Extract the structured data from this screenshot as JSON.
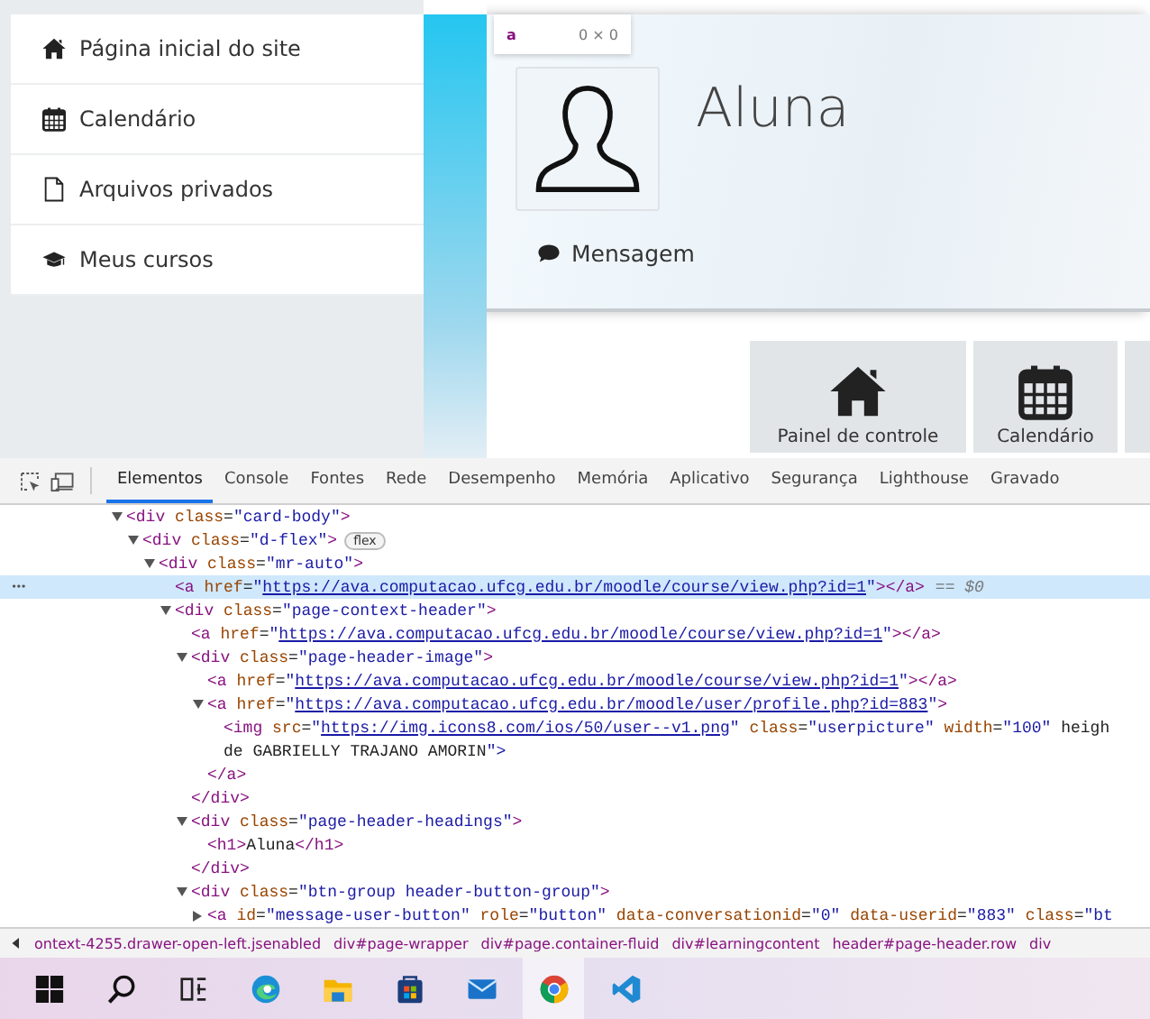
{
  "sidebar": {
    "items": [
      {
        "label": "Página inicial do site"
      },
      {
        "label": "Calendário"
      },
      {
        "label": "Arquivos privados"
      },
      {
        "label": "Meus cursos"
      }
    ]
  },
  "inspect_tooltip": {
    "tag": "a",
    "size": "0 × 0"
  },
  "page_header": {
    "name": "Aluna",
    "message_button": "Mensagem"
  },
  "tiles": [
    {
      "label": "Painel de controle"
    },
    {
      "label": "Calendário"
    }
  ],
  "devtools": {
    "tabs": [
      {
        "label": "Elementos",
        "selected": true
      },
      {
        "label": "Console",
        "selected": false
      },
      {
        "label": "Fontes",
        "selected": false
      },
      {
        "label": "Rede",
        "selected": false
      },
      {
        "label": "Desempenho",
        "selected": false
      },
      {
        "label": "Memória",
        "selected": false
      },
      {
        "label": "Aplicativo",
        "selected": false
      },
      {
        "label": "Segurança",
        "selected": false
      },
      {
        "label": "Lighthouse",
        "selected": false
      },
      {
        "label": "Gravado",
        "selected": false
      }
    ],
    "dom_tree": [
      {
        "open": "<div class=\"card-body\">",
        "expanded": true,
        "selected": false,
        "children": [
          {
            "open": "<div class=\"d-flex\">",
            "badge": "flex",
            "expanded": true,
            "selected": false,
            "children": [
              {
                "open": "<div class=\"mr-auto\">",
                "expanded": true,
                "selected": false,
                "children": [
                  {
                    "open": "<a href=\"https://ava.computacao.ufcg.edu.br/moodle/course/view.php?id=1\"></a>",
                    "suffix": "== $0",
                    "menu": "•••",
                    "selected": true
                  },
                  {
                    "open": "<div class=\"page-context-header\">",
                    "expanded": true,
                    "selected": false,
                    "children": [
                      {
                        "open": "<a href=\"https://ava.computacao.ufcg.edu.br/moodle/course/view.php?id=1\"></a>",
                        "selected": false
                      },
                      {
                        "open": "<div class=\"page-header-image\">",
                        "expanded": true,
                        "selected": false,
                        "children": [
                          {
                            "open": "<a href=\"https://ava.computacao.ufcg.edu.br/moodle/course/view.php?id=1\"></a>",
                            "selected": false
                          },
                          {
                            "open": "<a href=\"https://ava.computacao.ufcg.edu.br/moodle/user/profile.php?id=883\">",
                            "expanded": true,
                            "selected": false,
                            "children": [
                              {
                                "open": "<img src=\"https://img.icons8.com/ios/50/user--v1.png\" class=\"userpicture\" width=\"100\" heigh",
                                "wrapped": "de GABRIELLY TRAJANO AMORIN\">",
                                "selected": false
                              }
                            ],
                            "close": "</a>"
                          }
                        ],
                        "close": "</div>"
                      },
                      {
                        "open": "<div class=\"page-header-headings\">",
                        "expanded": true,
                        "selected": false,
                        "children": [
                          {
                            "open": "<h1>Aluna</h1>",
                            "selected": false
                          }
                        ],
                        "close": "</div>"
                      },
                      {
                        "open": "<div class=\"btn-group header-button-group\">",
                        "expanded": true,
                        "selected": false,
                        "children": [
                          {
                            "open": "<a id=\"message-user-button\" role=\"button\" data-conversationid=\"0\" data-userid=\"883\" class=\"bt",
                            "expanded": false,
                            "selected": false
                          }
                        ]
                      }
                    ]
                  }
                ]
              }
            ]
          }
        ]
      }
    ],
    "breadcrumbs": [
      "ontext-4255.drawer-open-left.jsenabled",
      "div#page-wrapper",
      "div#page.container-fluid",
      "div#learningcontent",
      "header#page-header.row",
      "div"
    ]
  },
  "taskbar": [
    {
      "selected": false
    },
    {
      "selected": false
    },
    {
      "selected": false
    },
    {
      "selected": false
    },
    {
      "selected": false
    },
    {
      "selected": false
    },
    {
      "selected": false
    },
    {
      "selected": true
    },
    {
      "selected": false
    }
  ]
}
